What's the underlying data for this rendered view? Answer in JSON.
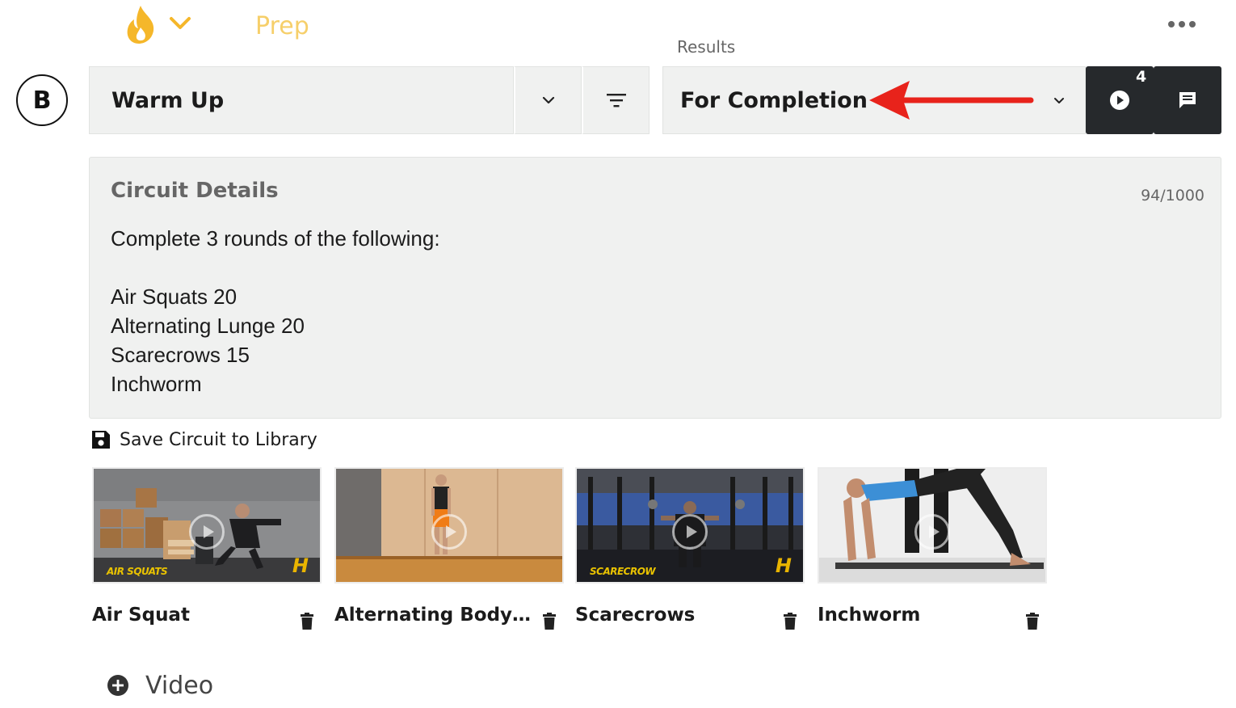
{
  "header": {
    "section_title": "Prep",
    "results_label": "Results"
  },
  "avatar": {
    "initial": "B"
  },
  "circuit_type": {
    "selected": "Warm Up"
  },
  "results_type": {
    "selected": "For Completion"
  },
  "media_badge": {
    "count": "4"
  },
  "details": {
    "title": "Circuit Details",
    "char_count": "94/1000",
    "text": "Complete 3 rounds of the following:\n\nAir Squats 20\nAlternating Lunge 20\nScarecrows 15\nInchworm"
  },
  "save_library": {
    "label": "Save Circuit to Library"
  },
  "videos": [
    {
      "title": "Air Squat",
      "caption": "AIR SQUATS",
      "logo": "H"
    },
    {
      "title": "Alternating Bodyw...",
      "caption": "",
      "logo": ""
    },
    {
      "title": "Scarecrows",
      "caption": "SCARECROW",
      "logo": "H"
    },
    {
      "title": "Inchworm",
      "caption": "",
      "logo": ""
    }
  ],
  "add_video": {
    "label": "Video"
  },
  "colors": {
    "accent": "#f5b72a",
    "prep_text": "#f6cf6a",
    "dark_button": "#26292c",
    "panel_bg": "#f0f1f0",
    "arrow": "#e8231b"
  },
  "icons": [
    "flame-icon",
    "chevron-down-icon",
    "more-horizontal-icon",
    "filter-icon",
    "play-circle-icon",
    "message-icon",
    "save-icon",
    "trash-icon",
    "plus-circle-icon"
  ]
}
